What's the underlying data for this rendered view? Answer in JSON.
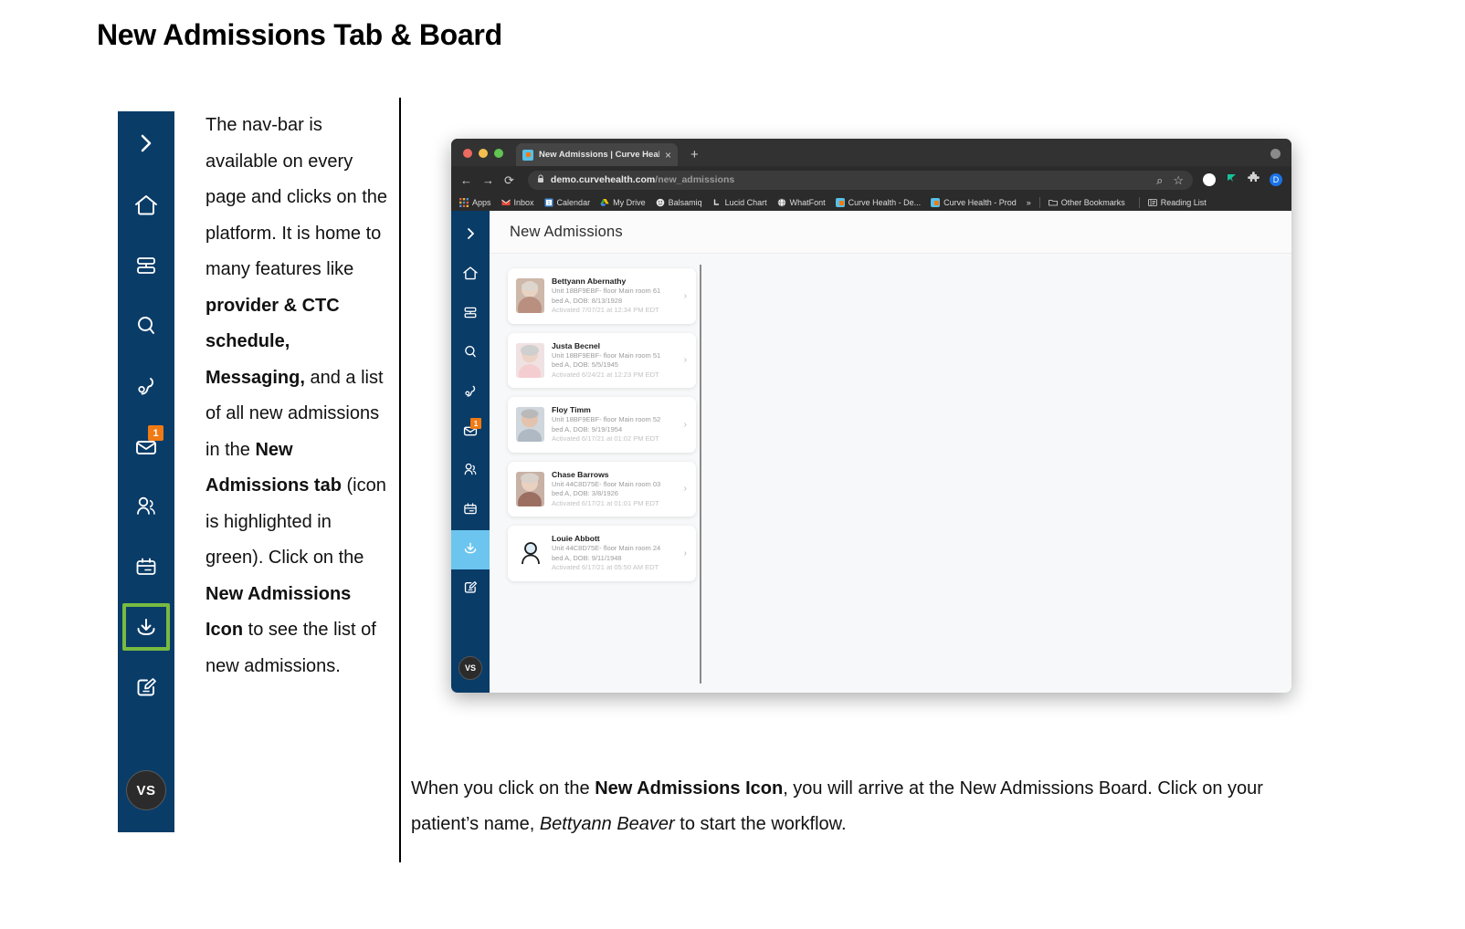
{
  "document": {
    "title": "New Admissions Tab & Board"
  },
  "colors": {
    "navy": "#0a3c68",
    "highlight_green": "#77bb41",
    "active_blue": "#6cc5ef",
    "badge_orange": "#f07a13"
  },
  "navbar": {
    "items": [
      {
        "name": "expand-chevron",
        "icon": "chevron-right-icon",
        "label": "Expand"
      },
      {
        "name": "home",
        "icon": "home-icon",
        "label": "Home"
      },
      {
        "name": "schedule",
        "icon": "schedule-icon",
        "label": "Schedule"
      },
      {
        "name": "search",
        "icon": "search-icon",
        "label": "Search"
      },
      {
        "name": "calls",
        "icon": "phone-icon",
        "label": "Calls"
      },
      {
        "name": "messages",
        "icon": "envelope-icon",
        "label": "Messaging",
        "badge": "1"
      },
      {
        "name": "patients",
        "icon": "people-icon",
        "label": "Patients"
      },
      {
        "name": "calendar",
        "icon": "calendar-icon",
        "label": "Calendar"
      },
      {
        "name": "new-admissions",
        "icon": "download-tray-icon",
        "label": "New Admissions",
        "highlighted": true
      },
      {
        "name": "notes",
        "icon": "edit-square-icon",
        "label": "Notes"
      }
    ],
    "avatar_initials": "VS"
  },
  "body_copy": {
    "segments": [
      {
        "text": "The nav-bar is available on every page and clicks on the platform. It is home to many features like ",
        "bold": false
      },
      {
        "text": "provider & CTC schedule, Messaging,",
        "bold": true
      },
      {
        "text": " and a list of all new admissions in the ",
        "bold": false
      },
      {
        "text": "New Admissions tab",
        "bold": true
      },
      {
        "text": " (icon is highlighted in green). Click on the ",
        "bold": false
      },
      {
        "text": "New Admissions Icon",
        "bold": true
      },
      {
        "text": " to see the list of new admissions.",
        "bold": false
      }
    ]
  },
  "browser": {
    "tab": {
      "title": "New Admissions | Curve Health",
      "close_label": "×",
      "new_tab_label": "+"
    },
    "toolbar": {
      "back_label": "←",
      "forward_label": "→",
      "reload_label": "⟳",
      "lock_label": "🔒",
      "url_domain": "demo.curvehealth.com",
      "url_path": "/new_admissions",
      "search_label": "⌕",
      "bookmark_star_label": "☆",
      "profile_letter": "D"
    },
    "bookmarks": [
      {
        "label": "Apps",
        "icon": "apps-grid-icon"
      },
      {
        "label": "Inbox",
        "icon": "gmail-icon"
      },
      {
        "label": "Calendar",
        "icon": "calendar-icon"
      },
      {
        "label": "My Drive",
        "icon": "drive-icon"
      },
      {
        "label": "Balsamiq",
        "icon": "balsamiq-icon"
      },
      {
        "label": "Lucid Chart",
        "icon": "lucid-icon"
      },
      {
        "label": "WhatFont",
        "icon": "globe-icon"
      },
      {
        "label": "Curve Health - De...",
        "icon": "curve-favicon"
      },
      {
        "label": "Curve Health - Prod",
        "icon": "curve-favicon"
      }
    ],
    "bookmarks_overflow": "»",
    "other_bookmarks": "Other Bookmarks",
    "reading_list": "Reading List"
  },
  "app": {
    "header_title": "New Admissions",
    "nav_items": [
      {
        "name": "expand-chevron",
        "icon": "chevron-right-icon"
      },
      {
        "name": "home",
        "icon": "home-icon"
      },
      {
        "name": "schedule",
        "icon": "schedule-icon"
      },
      {
        "name": "search",
        "icon": "search-icon"
      },
      {
        "name": "calls",
        "icon": "phone-icon"
      },
      {
        "name": "messages",
        "icon": "envelope-icon",
        "badge": "1"
      },
      {
        "name": "patients",
        "icon": "people-icon"
      },
      {
        "name": "calendar",
        "icon": "calendar-icon"
      },
      {
        "name": "new-admissions",
        "icon": "download-tray-icon",
        "active": true
      },
      {
        "name": "notes",
        "icon": "edit-square-icon"
      }
    ],
    "avatar_initials": "VS",
    "patients": [
      {
        "name": "Bettyann Abernathy",
        "location": "Unit 18BF9EBF- floor Main room 61",
        "bed_dob": "bed A, DOB: 8/13/1928",
        "activated": "Activated 7/07/21 at 12:34 PM EDT",
        "has_photo": true,
        "chevron": "›"
      },
      {
        "name": "Justa Becnel",
        "location": "Unit 18BF9EBF- floor Main room 51",
        "bed_dob": "bed A, DOB: 5/5/1945",
        "activated": "Activated 6/24/21 at 12:23 PM EDT",
        "has_photo": true,
        "chevron": "›"
      },
      {
        "name": "Floy Timm",
        "location": "Unit 18BF9EBF- floor Main room 52",
        "bed_dob": "bed A, DOB: 9/19/1954",
        "activated": "Activated 6/17/21 at 01:02 PM EDT",
        "has_photo": true,
        "chevron": "›"
      },
      {
        "name": "Chase Barrows",
        "location": "Unit 44C8D75E- floor Main room 03",
        "bed_dob": "bed A, DOB: 3/8/1926",
        "activated": "Activated 6/17/21 at 01:01 PM EDT",
        "has_photo": true,
        "chevron": "›"
      },
      {
        "name": "Louie Abbott",
        "location": "Unit 44C8D75E- floor Main room 24",
        "bed_dob": "bed A, DOB: 9/11/1948",
        "activated": "Activated 6/17/21 at 05:50 AM EDT",
        "has_photo": false,
        "chevron": "›"
      }
    ]
  },
  "caption": {
    "segments": [
      {
        "text": "When you click on the ",
        "style": "normal"
      },
      {
        "text": "New Admissions Icon",
        "style": "bold"
      },
      {
        "text": ", you will arrive at the New Admissions Board. Click on your patient’s name, ",
        "style": "normal"
      },
      {
        "text": "Bettyann Beaver",
        "style": "italic"
      },
      {
        "text": " to start the workflow.",
        "style": "normal"
      }
    ]
  }
}
